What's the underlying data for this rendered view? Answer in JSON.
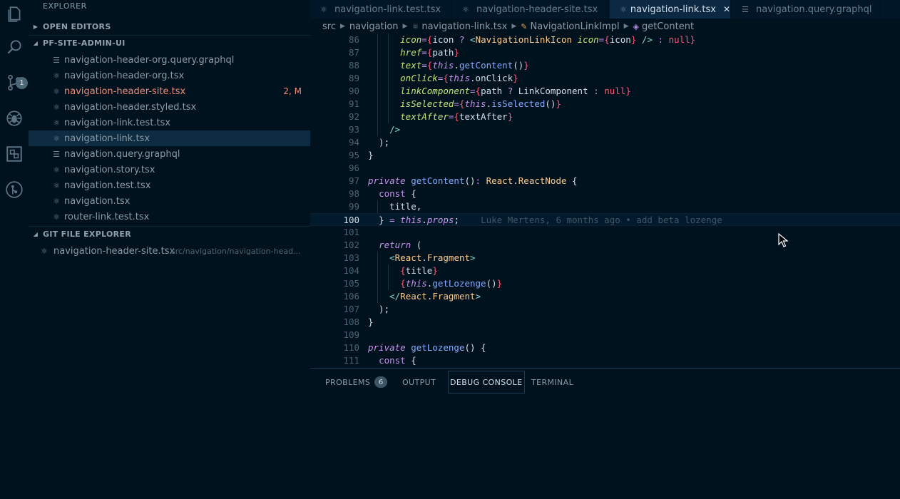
{
  "activity_bar": {
    "items": [
      {
        "icon": "files-icon"
      },
      {
        "icon": "search-icon"
      },
      {
        "icon": "source-control-icon",
        "badge": "1"
      },
      {
        "icon": "debug-icon"
      },
      {
        "icon": "extensions-icon"
      },
      {
        "icon": "git-lens-icon"
      }
    ]
  },
  "sidebar": {
    "title": "EXPLORER",
    "open_editors": "OPEN EDITORS",
    "project": "PF-SITE-ADMIN-UI",
    "files": [
      {
        "name": "navigation-header-org.query.graphql",
        "icon": "lines-icon"
      },
      {
        "name": "navigation-header-org.tsx",
        "icon": "react-icon"
      },
      {
        "name": "navigation-header-site.tsx",
        "icon": "react-icon",
        "status": "2, M"
      },
      {
        "name": "navigation-header.styled.tsx",
        "icon": "react-icon"
      },
      {
        "name": "navigation-link.test.tsx",
        "icon": "react-icon"
      },
      {
        "name": "navigation-link.tsx",
        "icon": "react-icon"
      },
      {
        "name": "navigation.query.graphql",
        "icon": "lines-icon"
      },
      {
        "name": "navigation.story.tsx",
        "icon": "react-icon"
      },
      {
        "name": "navigation.test.tsx",
        "icon": "react-icon"
      },
      {
        "name": "navigation.tsx",
        "icon": "react-icon"
      },
      {
        "name": "router-link.test.tsx",
        "icon": "react-icon"
      }
    ],
    "git_explorer": "GIT FILE EXPLORER",
    "git_file": {
      "name": "navigation-header-site.tsx",
      "path": "src/navigation/navigation-head..."
    }
  },
  "tabs": [
    {
      "label": "navigation-link.test.tsx",
      "icon": "react-icon"
    },
    {
      "label": "navigation-header-site.tsx",
      "icon": "react-icon"
    },
    {
      "label": "navigation-link.tsx",
      "icon": "react-icon",
      "close": "✕"
    },
    {
      "label": "navigation.query.graphql",
      "icon": "lines-icon"
    }
  ],
  "breadcrumb": [
    "src",
    "navigation",
    "navigation-link.tsx",
    "NavigationLinkImpl",
    "getContent"
  ],
  "code": {
    "current_line": "100",
    "blame": "Luke Mertens, 6 months ago • add beta lozenge",
    "lines": [
      {
        "n": "86",
        "text": "      icon={icon ? <NavigationLinkIcon icon={icon} /> : null}"
      },
      {
        "n": "87",
        "text": "      href={path}"
      },
      {
        "n": "88",
        "text": "      text={this.getContent()}"
      },
      {
        "n": "89",
        "text": "      onClick={this.onClick}"
      },
      {
        "n": "90",
        "text": "      linkComponent={path ? LinkComponent : null}"
      },
      {
        "n": "91",
        "text": "      isSelected={this.isSelected()}"
      },
      {
        "n": "92",
        "text": "      textAfter={textAfter}"
      },
      {
        "n": "93",
        "text": "    />"
      },
      {
        "n": "94",
        "text": "  );"
      },
      {
        "n": "95",
        "text": "}"
      },
      {
        "n": "96",
        "text": ""
      },
      {
        "n": "97",
        "text": "private getContent(): React.ReactNode {"
      },
      {
        "n": "98",
        "text": "  const {"
      },
      {
        "n": "99",
        "text": "    title,"
      },
      {
        "n": "100",
        "text": "  } = this.props;"
      },
      {
        "n": "101",
        "text": ""
      },
      {
        "n": "102",
        "text": "  return ("
      },
      {
        "n": "103",
        "text": "    <React.Fragment>"
      },
      {
        "n": "104",
        "text": "      {title}"
      },
      {
        "n": "105",
        "text": "      {this.getLozenge()}"
      },
      {
        "n": "106",
        "text": "    </React.Fragment>"
      },
      {
        "n": "107",
        "text": "  );"
      },
      {
        "n": "108",
        "text": "}"
      },
      {
        "n": "109",
        "text": ""
      },
      {
        "n": "110",
        "text": "private getLozenge() {"
      },
      {
        "n": "111",
        "text": "  const {"
      }
    ]
  },
  "panel": {
    "tabs": [
      {
        "label": "PROBLEMS",
        "badge": "6"
      },
      {
        "label": "OUTPUT"
      },
      {
        "label": "DEBUG CONSOLE"
      },
      {
        "label": "TERMINAL"
      }
    ]
  },
  "colors": {
    "background": "#01121f",
    "active_tab": "#0b2942",
    "modified": "#ef8b76",
    "selection": "#0d2b41"
  }
}
